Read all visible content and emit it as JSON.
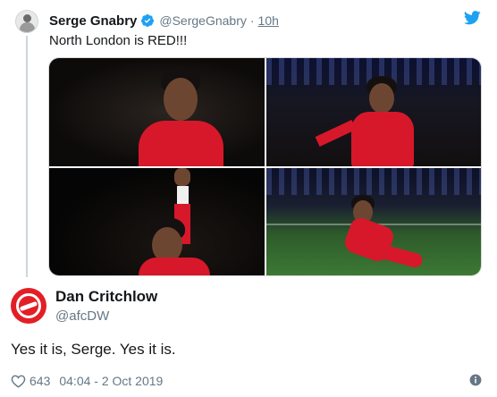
{
  "quoted_tweet": {
    "author_name": "Serge Gnabry",
    "author_handle": "@SergeGnabry",
    "separator": "·",
    "time": "10h",
    "text": "North London is RED!!!",
    "avatar_icon": "person-avatar",
    "verified_icon": "verified-badge-icon",
    "logo_icon": "twitter-bird-icon",
    "photos": [
      "photo-1",
      "photo-2",
      "photo-3",
      "photo-4"
    ]
  },
  "reply_tweet": {
    "author_name": "Dan Critchlow",
    "author_handle": "@afcDW",
    "avatar_icon": "arsenal-crest-avatar",
    "text": "Yes it is, Serge. Yes it is.",
    "like_count": "643",
    "timestamp": "04:04 - 2 Oct 2019",
    "info_icon": "info-icon"
  },
  "colors": {
    "text": "#14171a",
    "secondary": "#657786",
    "verified": "#1da1f2",
    "twitter_blue": "#1da1f2",
    "arsenal_red": "#e21f26",
    "bayern_red": "#d7182a"
  }
}
